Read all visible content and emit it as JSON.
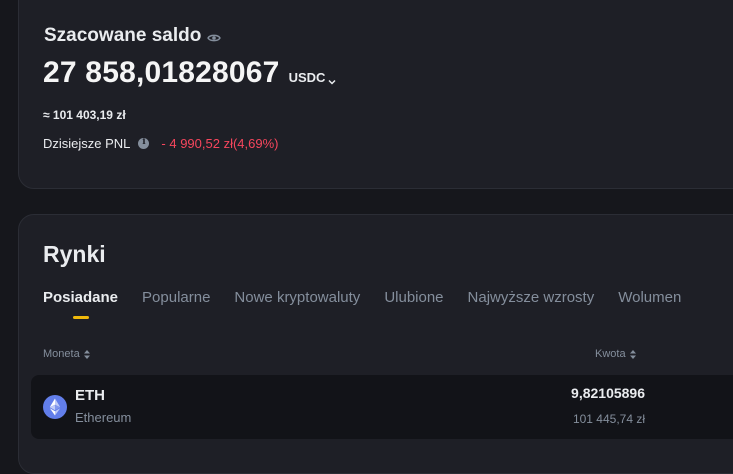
{
  "balance": {
    "title": "Szacowane saldo",
    "amount": "27 858,01828067",
    "currency": "USDC",
    "fiat_equivalent": "≈ 101 403,19 zł",
    "pnl_label": "Dzisiejsze PNL",
    "pnl_value": "- 4 990,52 zł(4,69%)"
  },
  "markets": {
    "title": "Rynki",
    "tabs": [
      {
        "label": "Posiadane"
      },
      {
        "label": "Popularne"
      },
      {
        "label": "Nowe kryptowaluty"
      },
      {
        "label": "Ulubione"
      },
      {
        "label": "Najwyższe wzrosty"
      },
      {
        "label": "Wolumen"
      }
    ],
    "columns": {
      "coin": "Moneta",
      "amount": "Kwota"
    },
    "rows": [
      {
        "symbol": "ETH",
        "name": "Ethereum",
        "quantity": "9,82105896",
        "fiat_value": "101 445,74 zł"
      }
    ]
  },
  "colors": {
    "accent": "#f0b90b",
    "negative": "#f6465d",
    "eth_icon": "#627eea"
  },
  "icons": {
    "visibility": "eye-icon",
    "currency_dropdown": "chevron-down-icon",
    "info": "info-icon",
    "sort": "sort-icon",
    "coin": "ethereum-icon"
  }
}
